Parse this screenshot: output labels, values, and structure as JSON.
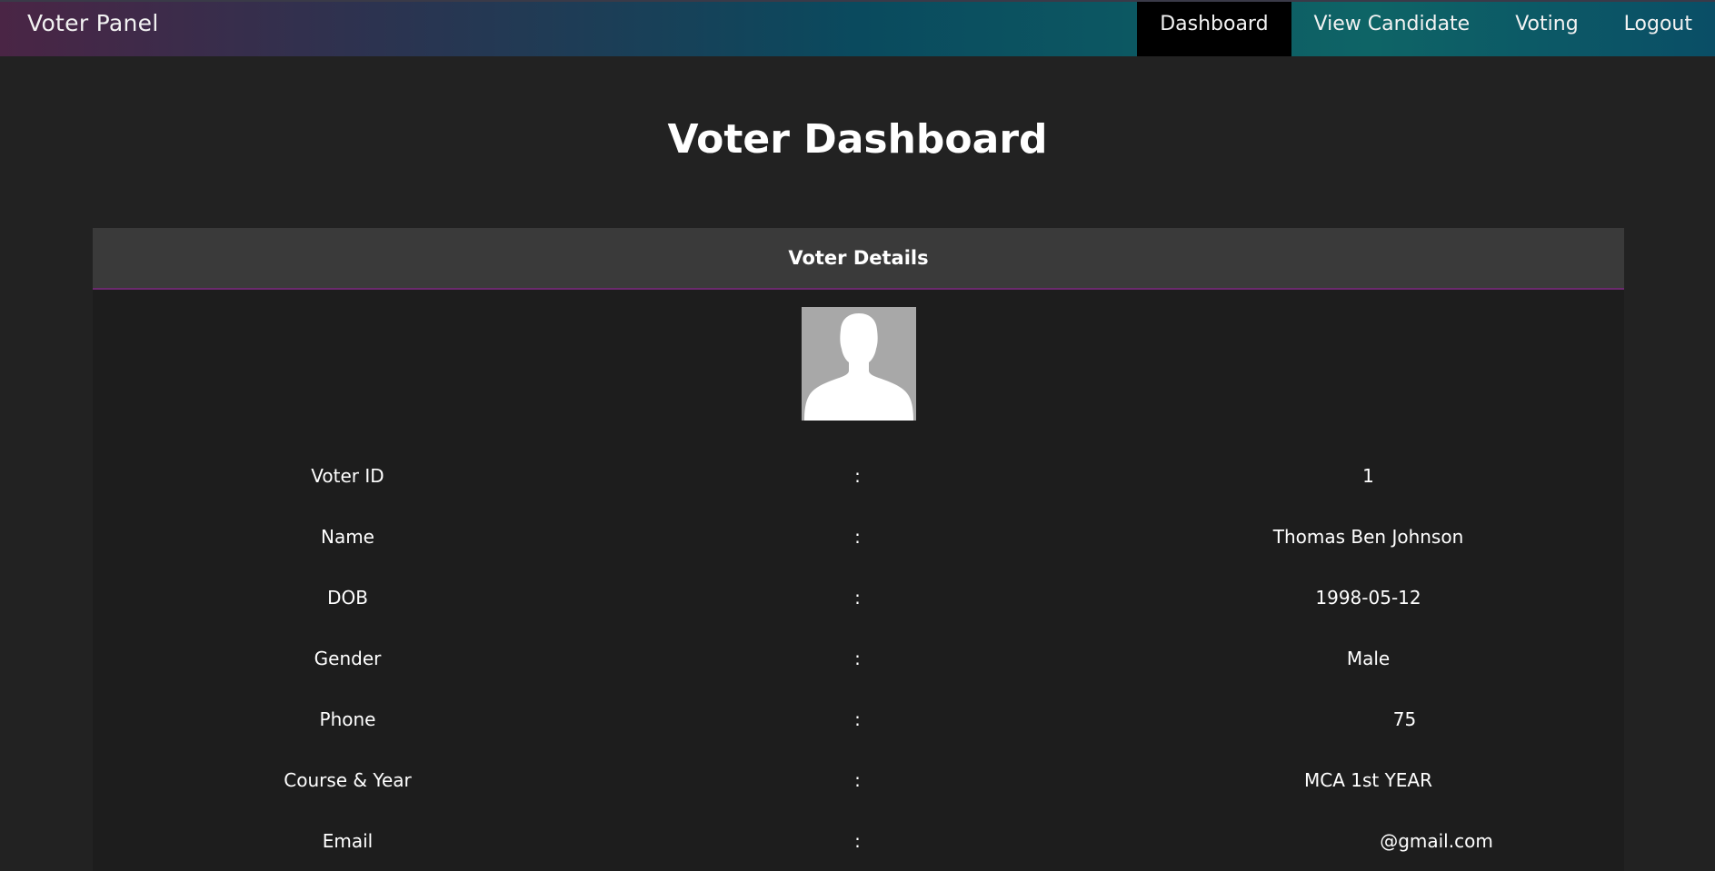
{
  "navbar": {
    "brand": "Voter Panel",
    "links": [
      {
        "label": "Dashboard",
        "active": true
      },
      {
        "label": "View Candidate",
        "active": false
      },
      {
        "label": "Voting",
        "active": false
      },
      {
        "label": "Logout",
        "active": false
      }
    ]
  },
  "page": {
    "title": "Voter Dashboard"
  },
  "card": {
    "header": "Voter Details",
    "avatar_icon": "person-silhouette-icon",
    "separator": ":",
    "rows": [
      {
        "label": "Voter ID",
        "value": "1"
      },
      {
        "label": "Name",
        "value": "Thomas Ben Johnson"
      },
      {
        "label": "DOB",
        "value": "1998-05-12"
      },
      {
        "label": "Gender",
        "value": "Male"
      },
      {
        "label": "Phone",
        "value": "75"
      },
      {
        "label": "Course & Year",
        "value": "MCA 1st YEAR"
      },
      {
        "label": "Email",
        "value": "@gmail.com"
      }
    ]
  },
  "colors": {
    "background": "#222222",
    "card_background": "#1d1d1d",
    "card_header_background": "#3a3a3a",
    "header_underline": "#6b2a6e",
    "active_nav": "#000000"
  }
}
